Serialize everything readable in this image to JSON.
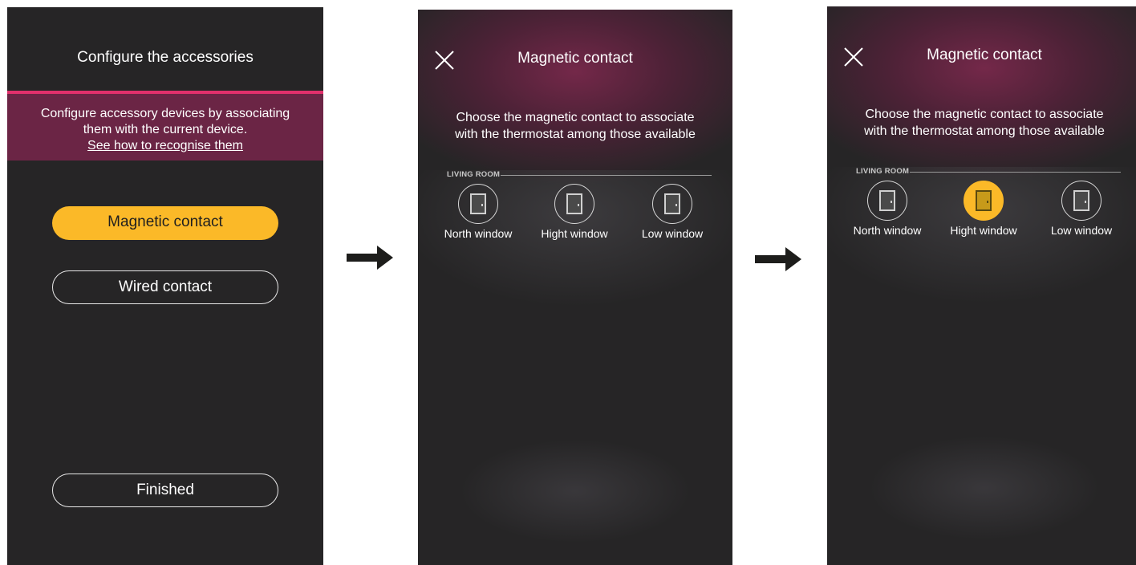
{
  "screen1": {
    "title": "Configure the accessories",
    "description_line1": "Configure accessory devices by associating",
    "description_line2": "them with the current device.",
    "link": "See how to recognise them",
    "buttons": {
      "magnetic": "Magnetic contact",
      "wired": "Wired contact",
      "finished": "Finished"
    }
  },
  "screen2": {
    "title": "Magnetic contact",
    "prompt_line1": "Choose the magnetic contact to associate",
    "prompt_line2": "with the thermostat among those available",
    "room": "LIVING ROOM",
    "items": [
      "North window",
      "Hight window",
      "Low window"
    ]
  },
  "screen3": {
    "title": "Magnetic contact",
    "prompt_line1": "Choose the magnetic contact to associate",
    "prompt_line2": "with the thermostat among those available",
    "room": "LIVING ROOM",
    "items": [
      "North window",
      "Hight window",
      "Low window"
    ],
    "selected": "Hight window"
  },
  "colors": {
    "accent": "#fbb928",
    "pink": "#e2306c",
    "background": "#262526"
  },
  "icons": {
    "close": "close-icon",
    "door": "door-icon",
    "arrow": "arrow-right-icon"
  }
}
